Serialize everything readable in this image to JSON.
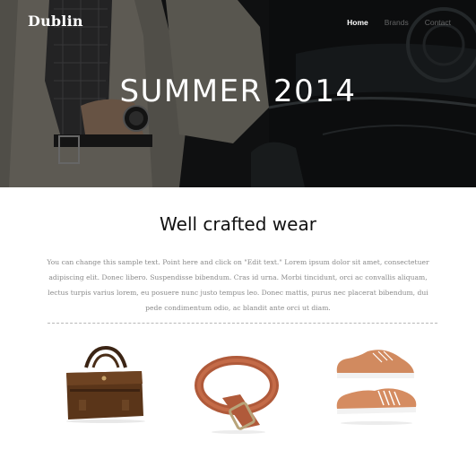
{
  "header": {
    "brand": "Dublin",
    "nav": [
      {
        "label": "Home",
        "active": true
      },
      {
        "label": "Brands",
        "active": false
      },
      {
        "label": "Contact",
        "active": false
      }
    ]
  },
  "hero": {
    "title": "SUMMER 2014"
  },
  "content": {
    "heading": "Well crafted wear",
    "paragraph": "You can change this sample text. Point here and click on \"Edit text.\" Lorem ipsum dolor sit amet, consectetuer adipiscing elit. Donec libero. Suspendisse bibendum. Cras id urna. Morbi tincidunt, orci ac convallis aliquam, lectus turpis varius lorem, eu posuere nunc justo tempus leo. Donec mattis, purus nec placerat bibendum, dui pede condimentum odio, ac blandit ante orci ut diam."
  },
  "products": [
    {
      "name": "handbag-image"
    },
    {
      "name": "belt-image"
    },
    {
      "name": "shoes-image"
    }
  ],
  "colors": {
    "accent_white": "#ffffff",
    "body_text": "#8a8a8a",
    "heading": "#111111",
    "divider": "#b8b8b8"
  }
}
